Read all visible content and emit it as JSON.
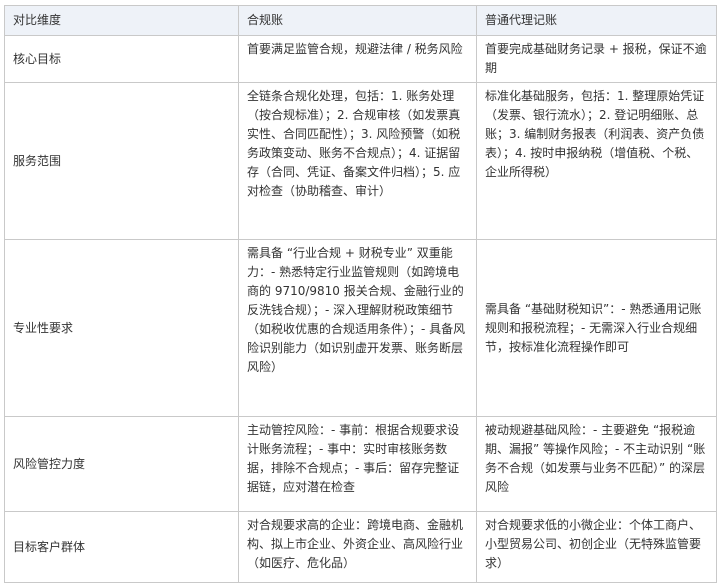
{
  "table": {
    "headers": [
      "对比维度",
      "合规账",
      "普通代理记账"
    ],
    "rows": [
      {
        "dimension": "核心目标",
        "compliance": "首要满足监管合规，规避法律 / 税务风险",
        "agency": "首要完成基础财务记录 + 报税，保证不逾期"
      },
      {
        "dimension": "服务范围",
        "compliance": "全链条合规化处理，包括：1. 账务处理（按合规标准）；2. 合规审核（如发票真实性、合同匹配性）；3. 风险预警（如税务政策变动、账务不合规点）；4. 证据留存（合同、凭证、备案文件归档）；5. 应对检查（协助稽查、审计）",
        "agency": "标准化基础服务，包括：1. 整理原始凭证（发票、银行流水）；2. 登记明细账、总账；3. 编制财务报表（利润表、资产负债表）；4. 按时申报纳税（增值税、个税、企业所得税）"
      },
      {
        "dimension": "专业性要求",
        "compliance": "需具备 “行业合规 + 财税专业” 双重能力：- 熟悉特定行业监管规则（如跨境电商的 9710/9810 报关合规、金融行业的反洗钱合规）；- 深入理解财税政策细节（如税收优惠的合规适用条件）；- 具备风险识别能力（如识别虚开发票、账务断层风险）",
        "agency": "需具备 “基础财税知识”：- 熟悉通用记账规则和报税流程；- 无需深入行业合规细节，按标准化流程操作即可"
      },
      {
        "dimension": "风险管控力度",
        "compliance": "主动管控风险：- 事前：根据合规要求设计账务流程；- 事中：实时审核账务数据，排除不合规点；- 事后：留存完整证据链，应对潜在检查",
        "agency": "被动规避基础风险：- 主要避免 “报税逾期、漏报” 等操作风险；- 不主动识别 “账务不合规（如发票与业务不匹配）” 的深层风险"
      },
      {
        "dimension": "目标客户群体",
        "compliance": "对合规要求高的企业：跨境电商、金融机构、拟上市企业、外资企业、高风险行业（如医疗、危化品）",
        "agency": "对合规要求低的小微企业：个体工商户、小型贸易公司、初创企业（无特殊监管要求）"
      }
    ]
  }
}
